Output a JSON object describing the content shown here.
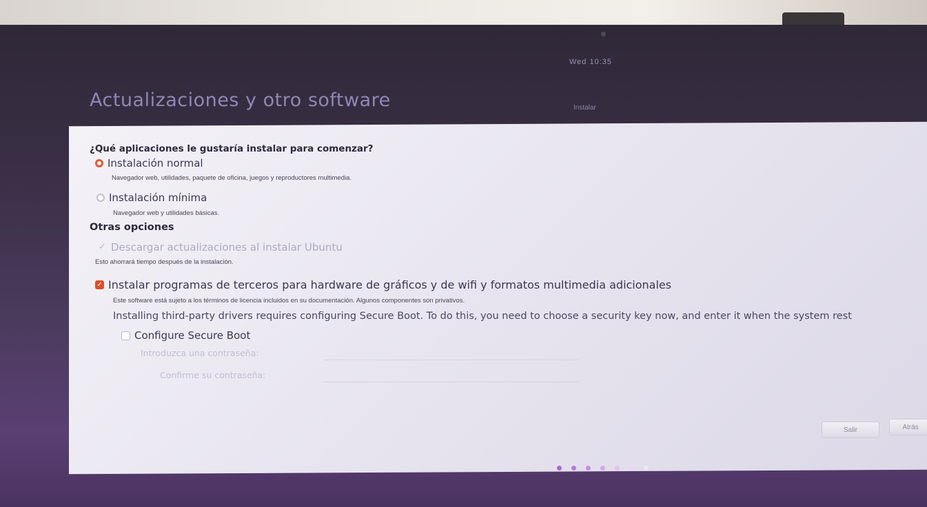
{
  "system": {
    "clock": "Wed 10:35",
    "window_title": "Instalar"
  },
  "page": {
    "heading": "Actualizaciones y otro software"
  },
  "install_type": {
    "question": "¿Qué aplicaciones le gustaría instalar para comenzar?",
    "options": [
      {
        "label": "Instalación normal",
        "description": "Navegador web, utilidades, paquete de oficina, juegos y reproductores multimedia.",
        "selected": true
      },
      {
        "label": "Instalación mínima",
        "description": "Navegador web y utilidades básicas.",
        "selected": false
      }
    ]
  },
  "other_options": {
    "heading": "Otras opciones",
    "download_updates": {
      "label": "Descargar actualizaciones al instalar Ubuntu",
      "description": "Esto ahorrará tiempo después de la instalación.",
      "checked": true,
      "disabled": true
    },
    "third_party": {
      "label": "Instalar programas de terceros para hardware de gráficos y de wifi y formatos multimedia adicionales",
      "description": "Este software está sujeto a los términos de licencia incluidos en su documentación. Algunos componentes son privativos.",
      "checked": true
    }
  },
  "secure_boot": {
    "note": "Installing third-party drivers requires configuring Secure Boot. To do this, you need to choose a security key now, and enter it when the system rest",
    "checkbox_label": "Configure Secure Boot",
    "checked": false,
    "password_label": "Introduzca una contraseña:",
    "confirm_label": "Confirme su contraseña:"
  },
  "buttons": {
    "quit": "Salir",
    "back": "Atrás"
  },
  "progress": {
    "total_steps": 7,
    "current_step": 3
  },
  "colors": {
    "accent": "#e25a33",
    "desktop_bg": "#4a3a5c",
    "panel_bg": "#eceaf2"
  }
}
